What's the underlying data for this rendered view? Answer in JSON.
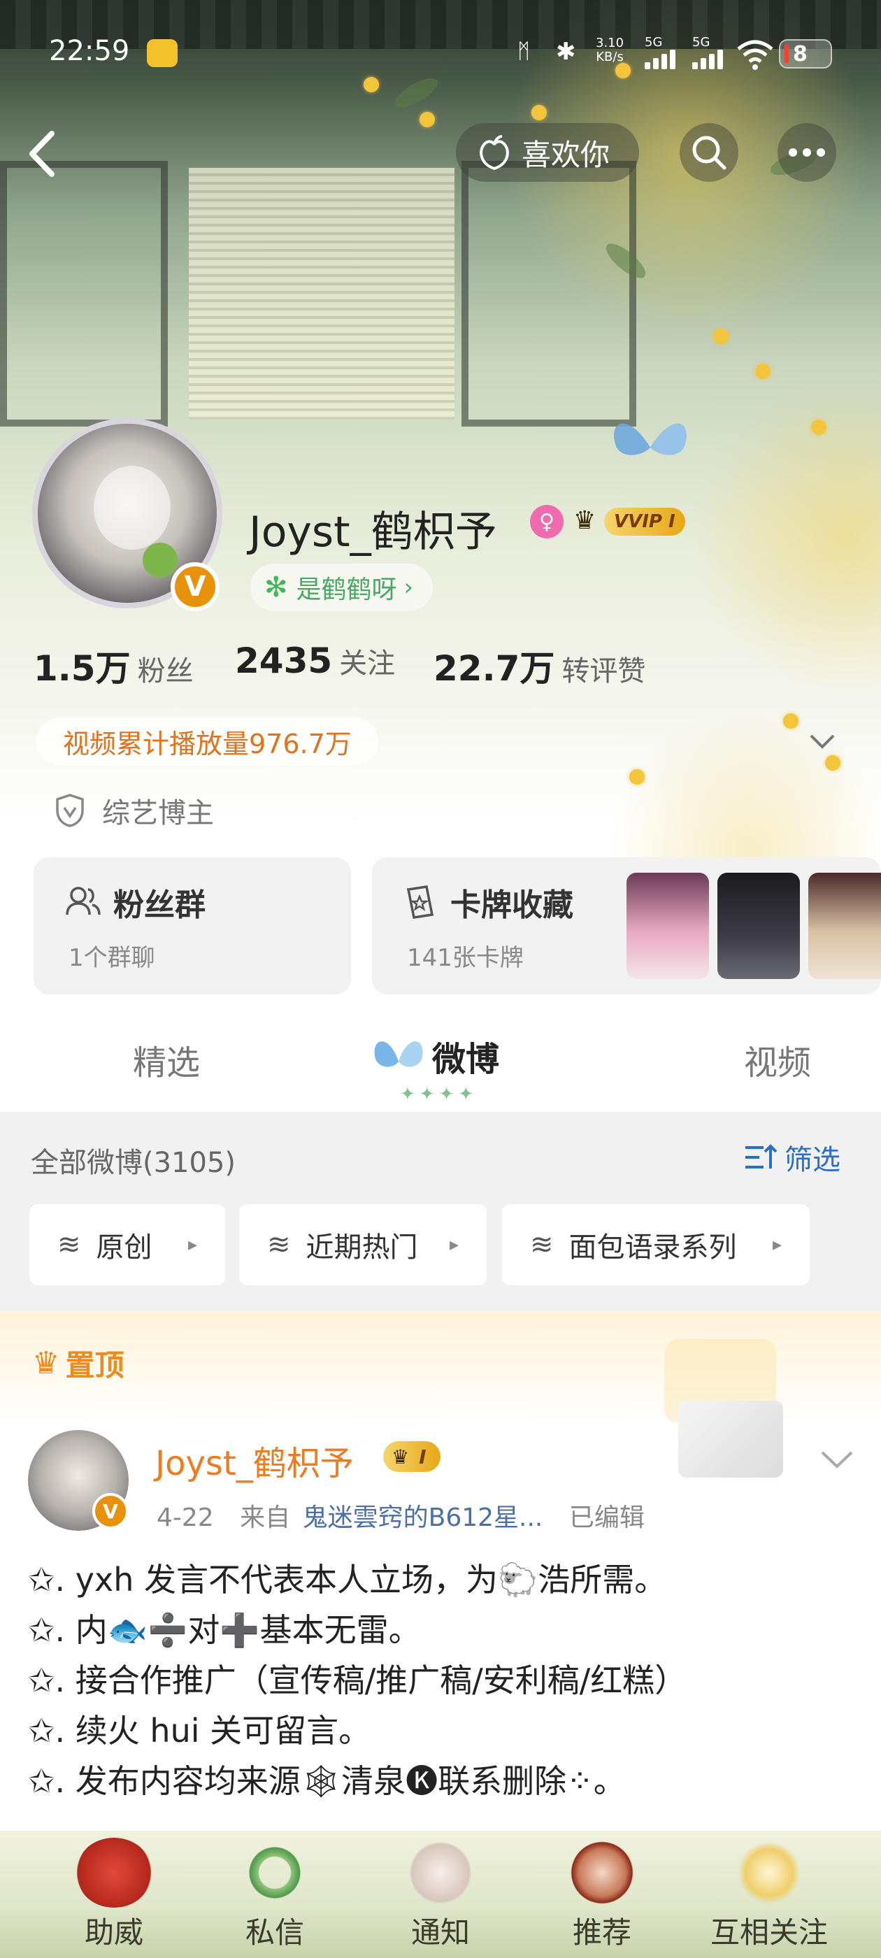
{
  "status_bar": {
    "time": "22:59",
    "net_speed_top": "3.10",
    "net_speed_bottom": "KB/s",
    "sig1": "5G",
    "sig2": "5G",
    "battery": "8"
  },
  "header": {
    "like_label": "喜欢你"
  },
  "profile": {
    "username": "Joyst_鹤枳予",
    "vip_label": "VVIP I",
    "group_tag": "是鹤鹤呀",
    "stats": [
      {
        "value": "1.5万",
        "label": "粉丝"
      },
      {
        "value": "2435",
        "label": "关注"
      },
      {
        "value": "22.7万",
        "label": "转评赞"
      }
    ],
    "video_plays": "视频累计播放量976.7万",
    "category": "综艺博主"
  },
  "cards": {
    "fans": {
      "title": "粉丝群",
      "sub": "1个群聊"
    },
    "collection": {
      "title": "卡牌收藏",
      "sub": "141张卡牌"
    }
  },
  "tabs": [
    {
      "label": "精选"
    },
    {
      "label": "微博"
    },
    {
      "label": "视频"
    }
  ],
  "feed": {
    "all_label": "全部微博(3105)",
    "filter_label": "筛选",
    "chips": [
      "原创",
      "近期热门",
      "面包语录系列"
    ]
  },
  "pinned": {
    "label": "置顶",
    "author": "Joyst_鹤枳予",
    "author_badge": "I",
    "date": "4-22",
    "from_prefix": "来自",
    "source": "鬼迷雲窍的B612星...",
    "edited": "已编辑",
    "lines": [
      "✩. yxh 发言不代表本人立场，为🐑浩所需。",
      "✩. 内🐟➗对➕基本无雷。",
      "✩. 接合作推广（宣传稿/推广稿/安利稿/红糕）",
      "✩. 续火 hui 关可留言。",
      "✩. 发布内容均来源🕸清泉🅚联系删除⁘。"
    ]
  },
  "bottom_bar": [
    {
      "label": "助威",
      "icon": "crab-icon"
    },
    {
      "label": "私信",
      "icon": "jade-bracelet-icon"
    },
    {
      "label": "通知",
      "icon": "doll-icon"
    },
    {
      "label": "推荐",
      "icon": "character-icon"
    },
    {
      "label": "互相关注",
      "icon": "bouquet-icon"
    }
  ]
}
